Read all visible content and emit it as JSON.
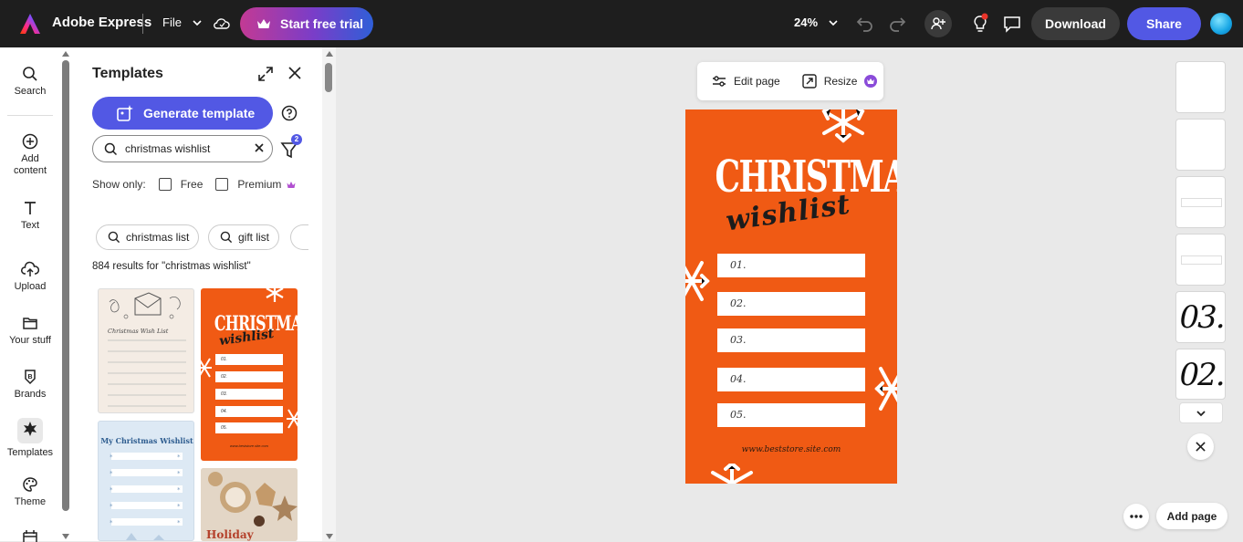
{
  "topbar": {
    "app_name": "Adobe Express",
    "file_label": "File",
    "trial_label": "Start free trial",
    "zoom": "24%",
    "download_label": "Download",
    "share_label": "Share"
  },
  "rail": {
    "items": [
      {
        "label": "Search",
        "icon": "search-icon"
      },
      {
        "label": "Add content",
        "icon": "plus-circle-icon"
      },
      {
        "label": "Text",
        "icon": "text-icon"
      },
      {
        "label": "Upload",
        "icon": "upload-icon"
      },
      {
        "label": "Your stuff",
        "icon": "folder-icon"
      },
      {
        "label": "Brands",
        "icon": "brand-icon"
      },
      {
        "label": "Templates",
        "icon": "templates-icon"
      },
      {
        "label": "Theme",
        "icon": "palette-icon"
      }
    ]
  },
  "panel": {
    "title": "Templates",
    "generate_label": "Generate template",
    "search_value": "christmas wishlist",
    "filter_count": "2",
    "show_only_label": "Show only:",
    "free_label": "Free",
    "premium_label": "Premium",
    "chips": [
      "christmas list",
      "gift list"
    ],
    "results_text": "884 results for \"christmas wishlist\"",
    "thumbs": {
      "t1_title": "Christmas Wish List",
      "t2_title": "CHRISTMAS",
      "t2_sub": "wishlist",
      "t2_items": [
        "01.",
        "02.",
        "03.",
        "04.",
        "05."
      ],
      "t2_url": "www.beststore.site.com",
      "t3_title": "My Christmas Wishlist",
      "t4_title": "Holiday"
    }
  },
  "canvas": {
    "edit_page_label": "Edit page",
    "resize_label": "Resize",
    "design": {
      "title": "CHRISTMAS",
      "subtitle": "wishlist",
      "items": [
        "01.",
        "02.",
        "03.",
        "04.",
        "05."
      ],
      "url": "www.beststore.site.com",
      "bg_color": "#f05a14"
    }
  },
  "pages": {
    "thumb_numbers": [
      "03.",
      "02."
    ],
    "add_page_label": "Add page"
  }
}
